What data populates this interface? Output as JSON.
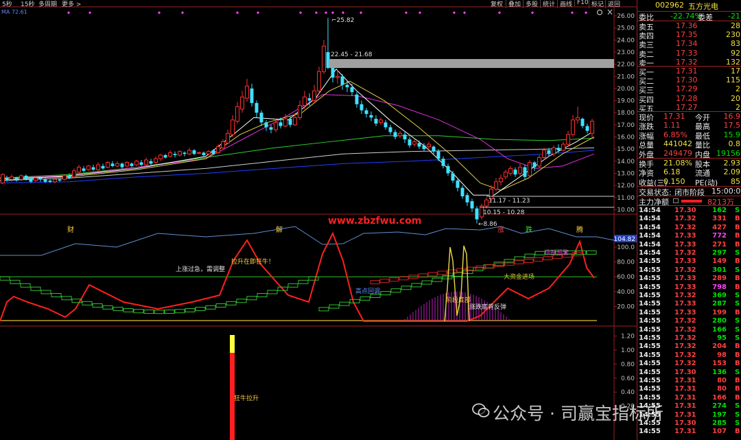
{
  "toolbar": {
    "left_items": [
      "5秒",
      "15秒",
      "多周期",
      "更多 >"
    ],
    "right_items": [
      "复权",
      "叠加",
      "多股",
      "统计",
      "画线",
      "F10",
      "标记",
      "返回"
    ]
  },
  "indicator_label": "MA 72.61",
  "price_axis": [
    "26.00",
    "25.00",
    "24.00",
    "23.00",
    "22.00",
    "21.00",
    "20.00",
    "19.00",
    "18.00",
    "17.00",
    "16.00",
    "15.00",
    "14.00",
    "13.00",
    "12.00",
    "11.00",
    "10.00"
  ],
  "annotations": {
    "high": "25.82",
    "zone": "22.45 - 21.68",
    "mid_zone": "11.17 - 11.23",
    "low_zone": "10.15 - 10.28",
    "low": "8.86",
    "website": "www.zbzfwu.com",
    "tag_cai": "财",
    "tag_jie": "解",
    "tag_zhang": "涨",
    "tag_die": "跌",
    "tag_zhang2": "腾"
  },
  "osc_axis": [
    "100.0",
    "80.00",
    "60.00",
    "40.00",
    "20.00"
  ],
  "osc_top_value": "104.82",
  "osc_labels": {
    "consolidation": "上涨过急，需调整",
    "rise": "拉升在即狂牛！",
    "high_return": "高点回调",
    "bottom": "阶段底部",
    "rebound": "涨跌底背反弹",
    "big_fund": "大资金进场",
    "top": "顶部预警"
  },
  "vol_axis": [
    "1.20",
    "1.00",
    "0.80",
    "0.60",
    "0.40",
    "0.20"
  ],
  "vol_label": "狂牛拉升",
  "quote": {
    "code": "002962",
    "name": "五方光电",
    "weibi_label": "委比",
    "weibi": "-22.74%",
    "weicha_label": "委差",
    "weicha": "-21",
    "asks": [
      {
        "label": "卖五",
        "price": "17.36",
        "vol": "28"
      },
      {
        "label": "卖四",
        "price": "17.35",
        "vol": "230"
      },
      {
        "label": "卖三",
        "price": "17.34",
        "vol": "83"
      },
      {
        "label": "卖二",
        "price": "17.33",
        "vol": "92"
      },
      {
        "label": "卖一",
        "price": "17.32",
        "vol": "132"
      }
    ],
    "bids": [
      {
        "label": "买一",
        "price": "17.31",
        "vol": "17"
      },
      {
        "label": "买二",
        "price": "17.30",
        "vol": "115"
      },
      {
        "label": "买三",
        "price": "17.29",
        "vol": "2"
      },
      {
        "label": "买四",
        "price": "17.28",
        "vol": "20"
      },
      {
        "label": "买五",
        "price": "17.27",
        "vol": "2"
      }
    ],
    "stats": [
      {
        "l1": "现价",
        "v1": "17.31",
        "l2": "今开",
        "v2": "16.9"
      },
      {
        "l1": "涨跌",
        "v1": "1.11",
        "l2": "最高",
        "v2": "17.5"
      },
      {
        "l1": "涨幅",
        "v1": "6.85%",
        "l2": "最低",
        "v2": "15.9"
      },
      {
        "l1": "总量",
        "v1": "441042",
        "l2": "量比",
        "v2": "0.8"
      },
      {
        "l1": "外盘",
        "v1": "249479",
        "l2": "内盘",
        "v2": "19156"
      }
    ],
    "stats2": [
      {
        "l1": "换手",
        "v1": "21.08%",
        "l2": "股本",
        "v2": "2.93"
      },
      {
        "l1": "净资",
        "v1": "6.18",
        "l2": "流通",
        "v2": "2.09"
      },
      {
        "l1": "收益(三)",
        "v1": "0.150",
        "l2": "PE(动)",
        "v2": "85"
      }
    ],
    "trade_status_label": "交易状态:",
    "trade_status": "闭市阶段",
    "trade_time": "15:00:00",
    "main_flow_label": "主力净额",
    "main_flow": "8213万"
  },
  "trades": [
    {
      "t": "14:54",
      "p": "17.30",
      "v": "162",
      "s": "S"
    },
    {
      "t": "14:54",
      "p": "17.32",
      "v": "331",
      "s": "B"
    },
    {
      "t": "14:54",
      "p": "17.32",
      "v": "427",
      "s": "B"
    },
    {
      "t": "14:54",
      "p": "17.33",
      "v": "772",
      "s": "B"
    },
    {
      "t": "14:54",
      "p": "17.33",
      "v": "271",
      "s": "B"
    },
    {
      "t": "14:54",
      "p": "17.32",
      "v": "297",
      "s": "S"
    },
    {
      "t": "14:55",
      "p": "17.33",
      "v": "149",
      "s": "B"
    },
    {
      "t": "14:55",
      "p": "17.32",
      "v": "301",
      "s": "S"
    },
    {
      "t": "14:55",
      "p": "17.33",
      "v": "289",
      "s": "B"
    },
    {
      "t": "14:55",
      "p": "17.33",
      "v": "798",
      "s": "B"
    },
    {
      "t": "14:55",
      "p": "17.32",
      "v": "369",
      "s": "S"
    },
    {
      "t": "14:55",
      "p": "17.33",
      "v": "287",
      "s": "S"
    },
    {
      "t": "14:55",
      "p": "17.33",
      "v": "199",
      "s": "B"
    },
    {
      "t": "14:55",
      "p": "17.32",
      "v": "280",
      "s": "S"
    },
    {
      "t": "14:55",
      "p": "17.32",
      "v": "166",
      "s": "S"
    },
    {
      "t": "14:55",
      "p": "17.32",
      "v": "95",
      "s": "S"
    },
    {
      "t": "14:55",
      "p": "17.32",
      "v": "204",
      "s": "B"
    },
    {
      "t": "14:55",
      "p": "17.32",
      "v": "98",
      "s": "B"
    },
    {
      "t": "14:55",
      "p": "17.32",
      "v": "153",
      "s": "B"
    },
    {
      "t": "14:55",
      "p": "17.30",
      "v": "136",
      "s": "S"
    },
    {
      "t": "14:55",
      "p": "17.31",
      "v": "80",
      "s": "B"
    },
    {
      "t": "14:55",
      "p": "17.31",
      "v": "80",
      "s": "B"
    },
    {
      "t": "14:55",
      "p": "17.31",
      "v": "166",
      "s": "B"
    },
    {
      "t": "14:55",
      "p": "17.31",
      "v": "274",
      "s": "S"
    },
    {
      "t": "14:55",
      "p": "17.31",
      "v": "197",
      "s": "S"
    },
    {
      "t": "14:55",
      "p": "17.30",
      "v": "285",
      "s": "S"
    },
    {
      "t": "14:55",
      "p": "17.31",
      "v": "107",
      "s": "B"
    }
  ],
  "watermark": "公众号 · 司赢宝指标所"
}
